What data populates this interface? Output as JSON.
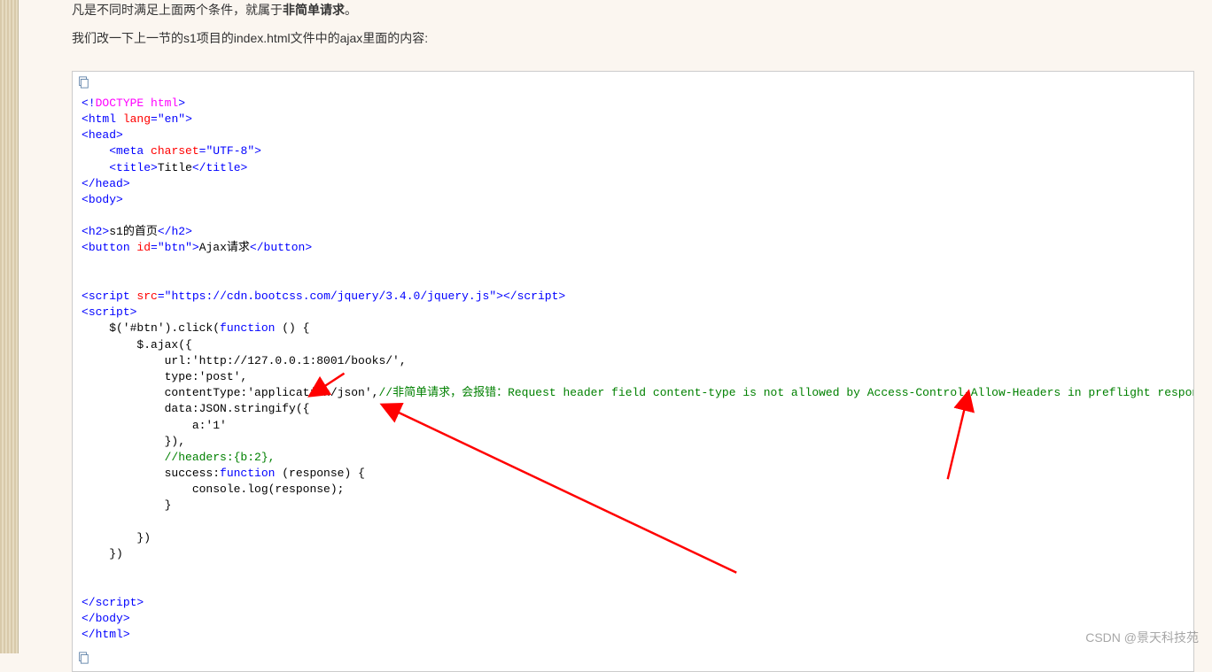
{
  "intro": {
    "line1_pre": "凡是不同时满足上面两个条件，就属于",
    "line1_strong": "非简单请求",
    "line1_post": "。",
    "line2": "我们改一下上一节的s1项目的index.html文件中的ajax里面的内容:"
  },
  "icons": {
    "copy_top": "copy-icon",
    "copy_bottom": "copy-icon"
  },
  "code": {
    "doctype_open": "<!",
    "doctype_body": "DOCTYPE html",
    "doctype_close": ">",
    "lt": "<",
    "gt": ">",
    "close": "</",
    "html_tag": "html",
    "html_lang_attr": " lang",
    "eq": "=",
    "q": "\"",
    "en": "en",
    "head": "head",
    "meta": "meta",
    "charset_attr": " charset",
    "utf8": "UTF-8",
    "title_tag": "title",
    "title_text": "Title",
    "body_tag": "body",
    "h2": "h2",
    "h2_text": "s1的首页",
    "button": "button",
    "id_attr": " id",
    "btn": "btn",
    "btn_text": "Ajax请求",
    "script_tag": "script",
    "src_attr": " src",
    "jquery_url": "https://cdn.bootcss.com/jquery/3.4.0/jquery.js",
    "js_click_line": "    $('#btn').click(",
    "function_kw": "function",
    "js_fn_args": " () {",
    "ajax_line": "        $.ajax({",
    "url_line": "            url:'http://127.0.0.1:8001/books/',",
    "type_line": "            type:'post',",
    "ct_line_pre": "            contentType:'application/json',",
    "ct_comment": "//非简单请求，会报错：Request header field content-type is not allowed by Access-Control-Allow-Headers in preflight response.",
    "data_line": "            data:JSON.stringify({",
    "a1_line": "                a:'1'",
    "close_brace_paren_line": "            }),",
    "headers_comment": "            //headers:{b:2},",
    "success_pre": "            success:",
    "success_args": " (response) {",
    "console_line": "                console.log(response);",
    "close_brace_line": "            }",
    "empty": "",
    "close_ajax1": "        })",
    "close_ajax2": "    })"
  },
  "watermark": "CSDN @景天科技苑"
}
